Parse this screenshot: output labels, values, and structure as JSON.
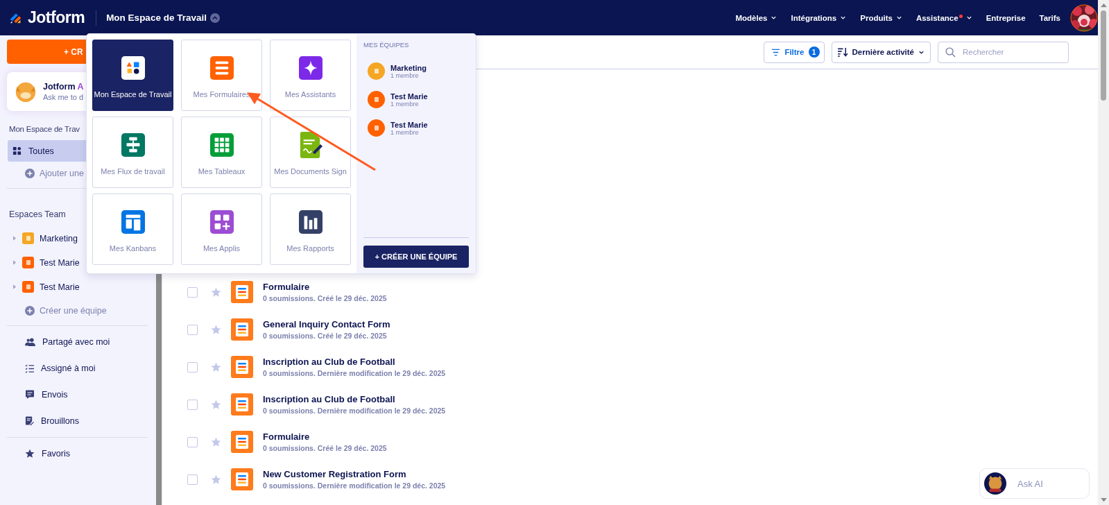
{
  "header": {
    "brand": "Jotform",
    "workspace": "Mon Espace de Travail",
    "menu_open": true,
    "nav": [
      {
        "label": "Modèles",
        "dropdown": true,
        "notification": false
      },
      {
        "label": "Intégrations",
        "dropdown": true,
        "notification": false
      },
      {
        "label": "Produits",
        "dropdown": true,
        "notification": false
      },
      {
        "label": "Assistance",
        "dropdown": true,
        "notification": true
      },
      {
        "label": "Entreprise",
        "dropdown": false,
        "notification": false
      },
      {
        "label": "Tarifs",
        "dropdown": false,
        "notification": false
      }
    ]
  },
  "sidebar": {
    "create_button": "+ CR",
    "assistant_card": {
      "title": "Jotform",
      "title_accent": "A",
      "subtitle": "Ask me to d"
    },
    "workspace_heading": "Mon Espace de Trav",
    "workspace_items": [
      {
        "label": "Toutes",
        "selected": true
      }
    ],
    "add_label": "Ajouter une",
    "teams_heading": "Espaces Team",
    "teams": [
      {
        "name": "Marketing",
        "color": "#f5a623"
      },
      {
        "name": "Test Marie",
        "color": "#ff6100"
      },
      {
        "name": "Test Marie",
        "color": "#ff6100"
      }
    ],
    "create_team": "Créer une équipe",
    "links": [
      {
        "label": "Partagé avec moi"
      },
      {
        "label": "Assigné à moi"
      },
      {
        "label": "Envois"
      },
      {
        "label": "Brouillons"
      }
    ],
    "favorites": "Favoris"
  },
  "toolbar": {
    "filter": {
      "label": "Filtre",
      "count": "1"
    },
    "sort": "Dernière activité",
    "search": {
      "placeholder": "Rechercher"
    }
  },
  "forms": [
    {
      "title": "Formulaire",
      "meta": "0 soumissions. Créé le 29 déc. 2025",
      "checked": false,
      "starred": false
    },
    {
      "title": "General Inquiry Contact Form",
      "meta": "0 soumissions. Créé le 29 déc. 2025",
      "checked": false,
      "starred": false
    },
    {
      "title": "Inscription au Club de Football",
      "meta": "0 soumissions. Dernière modification le 29 déc. 2025",
      "checked": false,
      "starred": false
    },
    {
      "title": "Inscription au Club de Football",
      "meta": "0 soumissions. Dernière modification le 29 déc. 2025",
      "checked": false,
      "starred": false
    },
    {
      "title": "Formulaire",
      "meta": "0 soumissions. Créé le 29 déc. 2025",
      "checked": false,
      "starred": false
    },
    {
      "title": "New Customer Registration Form",
      "meta": "0 soumissions. Dernière modification le 29 déc. 2025",
      "checked": false,
      "starred": false
    }
  ],
  "workspace_menu": {
    "tiles": [
      {
        "label": "Mon Espace de Travail",
        "selected": true,
        "color": "#ffffff"
      },
      {
        "label": "Mes Formulaires",
        "selected": false,
        "color": "#ff6100"
      },
      {
        "label": "Mes Assistants",
        "selected": false,
        "color": "#7d2ae8"
      },
      {
        "label": "Mes Flux de travail",
        "selected": false,
        "color": "#007862"
      },
      {
        "label": "Mes Tableaux",
        "selected": false,
        "color": "#049e38"
      },
      {
        "label": "Mes Documents Sign",
        "selected": false,
        "color": "#7bb60f"
      },
      {
        "label": "Mes Kanbans",
        "selected": false,
        "color": "#0075e3"
      },
      {
        "label": "Mes Applis",
        "selected": false,
        "color": "#9c4dd3"
      },
      {
        "label": "Mes Rapports",
        "selected": false,
        "color": "#344067"
      }
    ],
    "teams_heading": "MES ÉQUIPES",
    "teams": [
      {
        "name": "Marketing",
        "members": "1 membre",
        "color": "#f5a623"
      },
      {
        "name": "Test Marie",
        "members": "1 membre",
        "color": "#ff6100"
      },
      {
        "name": "Test Marie",
        "members": "1 membre",
        "color": "#ff6100"
      }
    ],
    "create_button": "+ CRÉER UNE ÉQUIPE"
  },
  "ask_ai": "Ask AI"
}
